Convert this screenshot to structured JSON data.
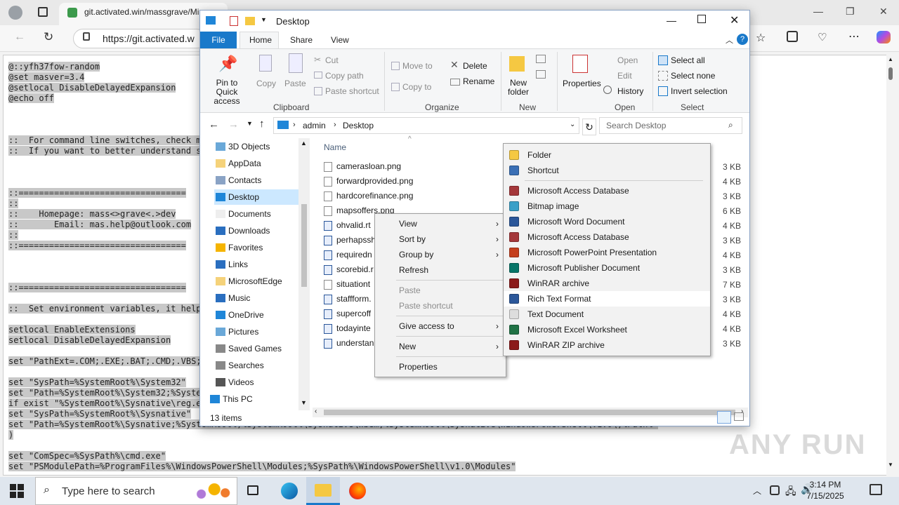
{
  "browser": {
    "tab_title": "git.activated.win/massgrave/Mi",
    "url": "https://git.activated.w"
  },
  "page_code": [
    "@::yfh37fow-random",
    "@set masver=3.4",
    "@setlocal DisableDelayedExpansion",
    "@echo off",
    "",
    "",
    "",
    "::  For command line switches, check m",
    "::  If you want to better understand s",
    "",
    "",
    "",
    "::=================================",
    "::",
    "::    Homepage: mass<>grave<.>dev",
    "::       Email: mas.help@outlook.com",
    "::",
    "::=================================",
    "",
    "",
    "",
    "::=================================",
    "",
    "::  Set environment variables, it help",
    "",
    "setlocal EnableExtensions",
    "setlocal DisableDelayedExpansion",
    "",
    "set \"PathExt=.COM;.EXE;.BAT;.CMD;.VBS;",
    "",
    "set \"SysPath=%SystemRoot%\\System32\"",
    "set \"Path=%SystemRoot%\\System32;%Syste",
    "if exist \"%SystemRoot%\\Sysnative\\reg.e",
    "set \"SysPath=%SystemRoot%\\Sysnative\"",
    "set \"Path=%SystemRoot%\\Sysnative;%SystemRoot%;%SystemRoot%\\Sysnative\\Wbem;%SystemRoot%\\Sysnative\\WindowsPowerShell\\v1.0\\;%Path%\"",
    ")",
    "",
    "set \"ComSpec=%SysPath%\\cmd.exe\"",
    "set \"PSModulePath=%ProgramFiles%\\WindowsPowerShell\\Modules;%SysPath%\\WindowsPowerShell\\v1.0\\Modules\""
  ],
  "explorer": {
    "title": "Desktop",
    "ribbon_tabs": [
      "File",
      "Home",
      "Share",
      "View"
    ],
    "clipboard": {
      "pin": "Pin to Quick access",
      "copy": "Copy",
      "paste": "Paste",
      "cut": "Cut",
      "copy_path": "Copy path",
      "paste_shortcut": "Paste shortcut",
      "label": "Clipboard"
    },
    "organize": {
      "move_to": "Move to",
      "copy_to": "Copy to",
      "delete": "Delete",
      "rename": "Rename",
      "label": "Organize"
    },
    "new_group": {
      "new_folder": "New folder",
      "label": "New"
    },
    "open_group": {
      "properties": "Properties",
      "open": "Open",
      "edit": "Edit",
      "history": "History",
      "label": "Open"
    },
    "select_group": {
      "select_all": "Select all",
      "select_none": "Select none",
      "invert": "Invert selection",
      "label": "Select"
    },
    "breadcrumb": [
      "admin",
      "Desktop"
    ],
    "search_placeholder": "Search Desktop",
    "nav_items": [
      "3D Objects",
      "AppData",
      "Contacts",
      "Desktop",
      "Documents",
      "Downloads",
      "Favorites",
      "Links",
      "MicrosoftEdge",
      "Music",
      "OneDrive",
      "Pictures",
      "Saved Games",
      "Searches",
      "Videos",
      "This PC"
    ],
    "column_name": "Name",
    "files": [
      {
        "name": "camerasloan.png",
        "size": "3 KB"
      },
      {
        "name": "forwardprovided.png",
        "size": "4 KB"
      },
      {
        "name": "hardcorefinance.png",
        "size": "3 KB"
      },
      {
        "name": "mapsoffers.png",
        "size": "6 KB"
      },
      {
        "name": "ohvalid.rt",
        "size": "4 KB"
      },
      {
        "name": "perhapssh",
        "size": "3 KB"
      },
      {
        "name": "requiredn",
        "size": "4 KB"
      },
      {
        "name": "scorebid.r",
        "size": "3 KB"
      },
      {
        "name": "situationt",
        "size": "7 KB"
      },
      {
        "name": "staffform.",
        "size": "3 KB"
      },
      {
        "name": "supercoff",
        "size": "4 KB"
      },
      {
        "name": "todayinte",
        "size": "4 KB"
      },
      {
        "name": "understan",
        "size": "3 KB"
      }
    ],
    "status": "13 items"
  },
  "context_menu": {
    "items": [
      "View",
      "Sort by",
      "Group by",
      "Refresh",
      "Paste",
      "Paste shortcut",
      "Give access to",
      "New",
      "Properties"
    ]
  },
  "new_submenu": {
    "items": [
      "Folder",
      "Shortcut",
      "Microsoft Access Database",
      "Bitmap image",
      "Microsoft Word Document",
      "Microsoft Access Database",
      "Microsoft PowerPoint Presentation",
      "Microsoft Publisher Document",
      "WinRAR archive",
      "Rich Text Format",
      "Text Document",
      "Microsoft Excel Worksheet",
      "WinRAR ZIP archive"
    ]
  },
  "taskbar": {
    "search_placeholder": "Type here to search",
    "time": "3:14 PM",
    "date": "7/15/2025"
  },
  "watermark": "ANY RUN"
}
